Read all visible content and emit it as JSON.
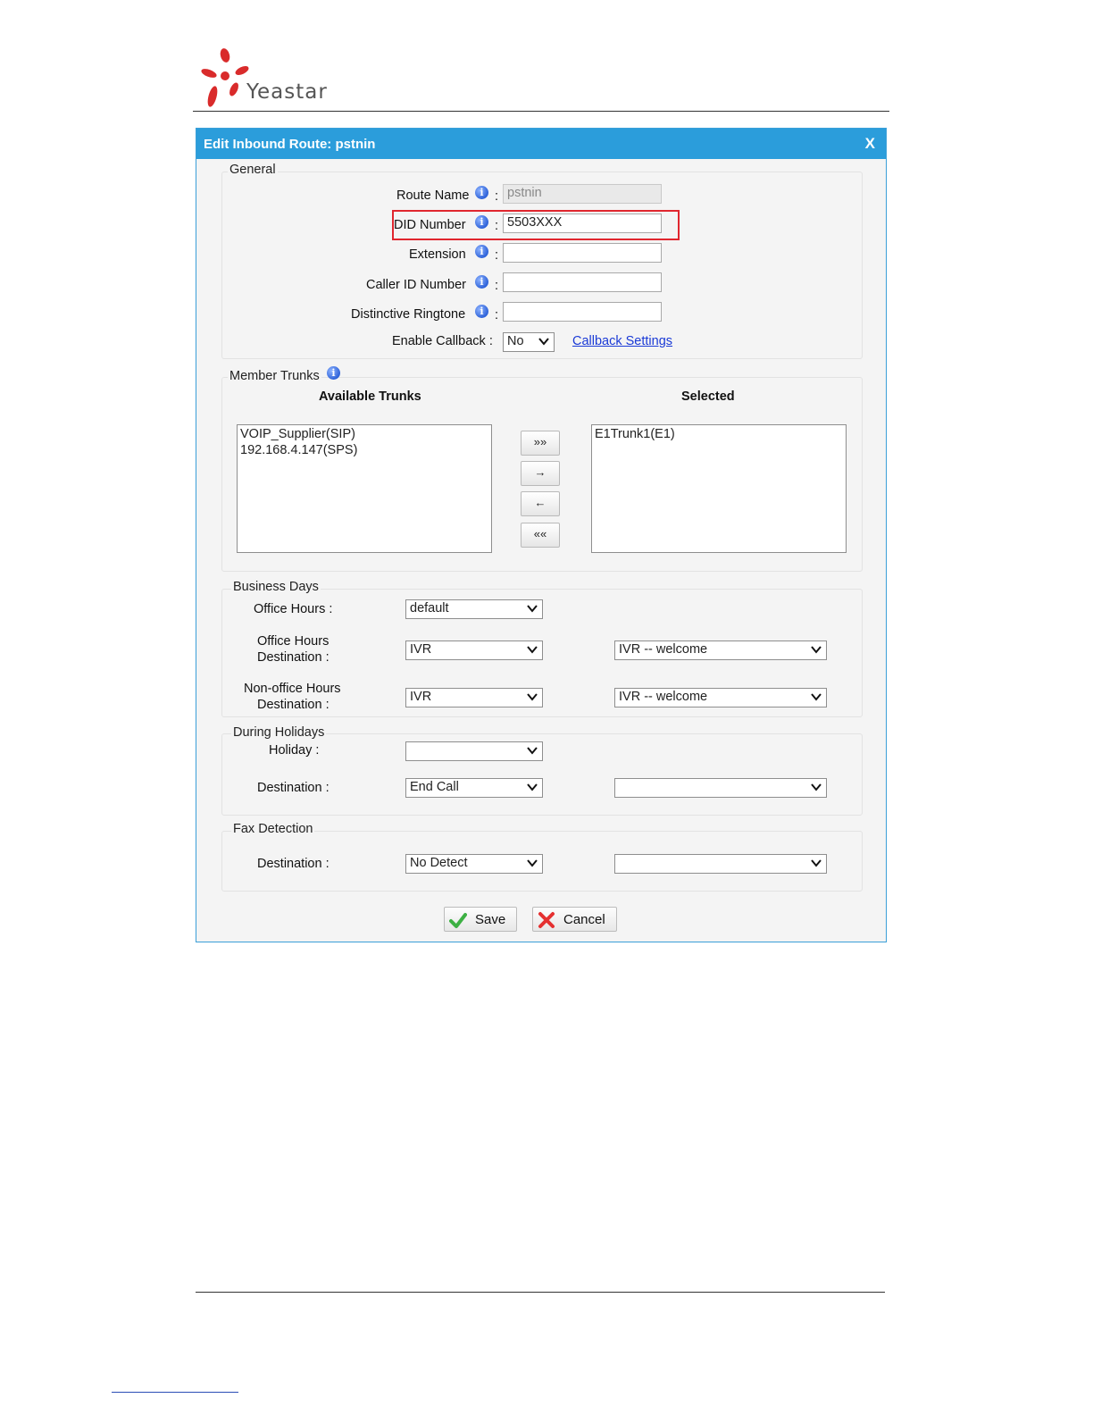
{
  "brand": {
    "name": "Yeastar",
    "logo_color": "#d92b2b"
  },
  "dialog": {
    "title": "Edit Inbound Route: pstnin",
    "close_label": "X",
    "accent_color": "#2b9ddb"
  },
  "general": {
    "legend": "General",
    "route_name": {
      "label": "Route Name",
      "value": "pstnin"
    },
    "did_number": {
      "label": "DID Number",
      "value": "5503XXX"
    },
    "extension": {
      "label": "Extension",
      "value": ""
    },
    "caller_id_number": {
      "label": "Caller ID Number",
      "value": ""
    },
    "distinctive_ringtone": {
      "label": "Distinctive Ringtone",
      "value": ""
    },
    "enable_callback": {
      "label": "Enable Callback :",
      "value": "No"
    },
    "callback_settings_link": "Callback Settings",
    "colon": ":"
  },
  "member_trunks": {
    "legend": "Member Trunks",
    "available_header": "Available Trunks",
    "selected_header": "Selected",
    "available": [
      "VOIP_Supplier(SIP)",
      "192.168.4.147(SPS)"
    ],
    "selected": [
      "E1Trunk1(E1)"
    ],
    "buttons": {
      "add_all": "»»",
      "add": "→",
      "remove": "←",
      "remove_all": "««"
    }
  },
  "business_days": {
    "legend": "Business Days",
    "office_hours": {
      "label": "Office Hours :",
      "value": "default"
    },
    "office_hours_destination": {
      "label_line1": "Office Hours",
      "label_line2": "Destination :",
      "type": "IVR",
      "target": "IVR -- welcome"
    },
    "non_office_hours_destination": {
      "label_line1": "Non-office Hours",
      "label_line2": "Destination :",
      "type": "IVR",
      "target": "IVR -- welcome"
    }
  },
  "holidays": {
    "legend": "During Holidays",
    "holiday": {
      "label": "Holiday :",
      "value": ""
    },
    "destination": {
      "label": "Destination :",
      "type": "End Call",
      "target": ""
    }
  },
  "fax": {
    "legend": "Fax Detection",
    "destination": {
      "label": "Destination :",
      "type": "No Detect",
      "target": ""
    }
  },
  "actions": {
    "save": "Save",
    "cancel": "Cancel"
  }
}
